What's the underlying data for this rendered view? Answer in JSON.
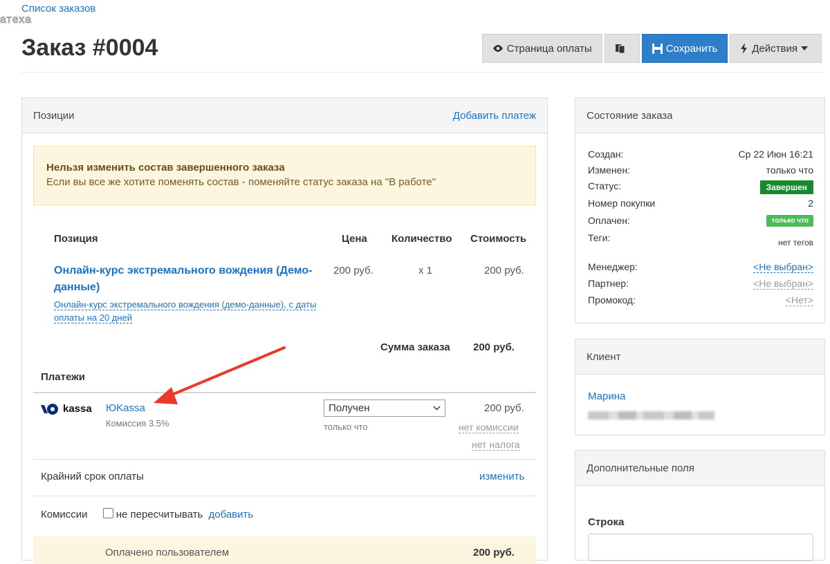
{
  "topnav": {
    "back_link": "Список заказов",
    "ghost_text": "атеха"
  },
  "page": {
    "title": "Заказ #0004"
  },
  "toolbar": {
    "payment_page": "Страница оплаты",
    "save": "Сохранить",
    "actions": "Действия"
  },
  "positions_panel": {
    "header": "Позиции",
    "add_payment": "Добавить платеж",
    "warning_title": "Нельзя изменить состав завершенного заказа",
    "warning_text": "Если вы все же хотите поменять состав - поменяйте статус заказа на \"В работе\"",
    "columns": {
      "position": "Позиция",
      "price": "Цена",
      "qty": "Количество",
      "cost": "Стоимость"
    },
    "item": {
      "name": "Онлайн-курс экстремального вождения (Демо-данные)",
      "subtitle": "Онлайн-курс экстремального вождения (демо-данные), с даты оплаты на 20 дней",
      "price": "200 руб.",
      "qty": "x 1",
      "cost": "200 руб."
    },
    "sum_label": "Сумма заказа",
    "sum_value": "200 руб.",
    "payments_label": "Платежи",
    "payment": {
      "logo_text": "kassa",
      "name": "ЮKassa",
      "commission_note": "Комиссия 3.5%",
      "status": "Получен",
      "status_time": "только что",
      "amount": "200 руб.",
      "no_commission": "нет комиссии",
      "no_tax": "нет налога"
    },
    "deadline_label": "Крайний срок оплаты",
    "deadline_action": "изменить",
    "commissions_label": "Комиссии",
    "no_recalc": "не пересчитывать",
    "add": "добавить",
    "paid_by_user": "Оплачено пользователем",
    "paid_value": "200 руб."
  },
  "status_panel": {
    "header": "Состояние заказа",
    "created_label": "Создан:",
    "created_value": "Ср 22 Июн 16:21",
    "changed_label": "Изменен:",
    "changed_value": "только что",
    "status_label": "Статус:",
    "status_value": "Завершен",
    "purchase_label": "Номер покупки",
    "purchase_value": "2",
    "paid_label": "Оплачен:",
    "paid_value": "только что",
    "tags_label": "Теги:",
    "tags_value": "нет тегов",
    "manager_label": "Менеджер:",
    "manager_value": "<Не выбран>",
    "partner_label": "Партнер:",
    "partner_value": "<Не выбран>",
    "promo_label": "Промокод:",
    "promo_value": "<Нет>"
  },
  "client_panel": {
    "header": "Клиент",
    "name": "Марина"
  },
  "extra_panel": {
    "header": "Дополнительные поля",
    "field_label": "Строка"
  },
  "colors": {
    "accent": "#2c7fc8",
    "status_complete": "#188a2e",
    "paid_badge": "#4dbb59",
    "warning_bg": "#fcf6e0",
    "annotation_arrow": "#e8392b"
  }
}
